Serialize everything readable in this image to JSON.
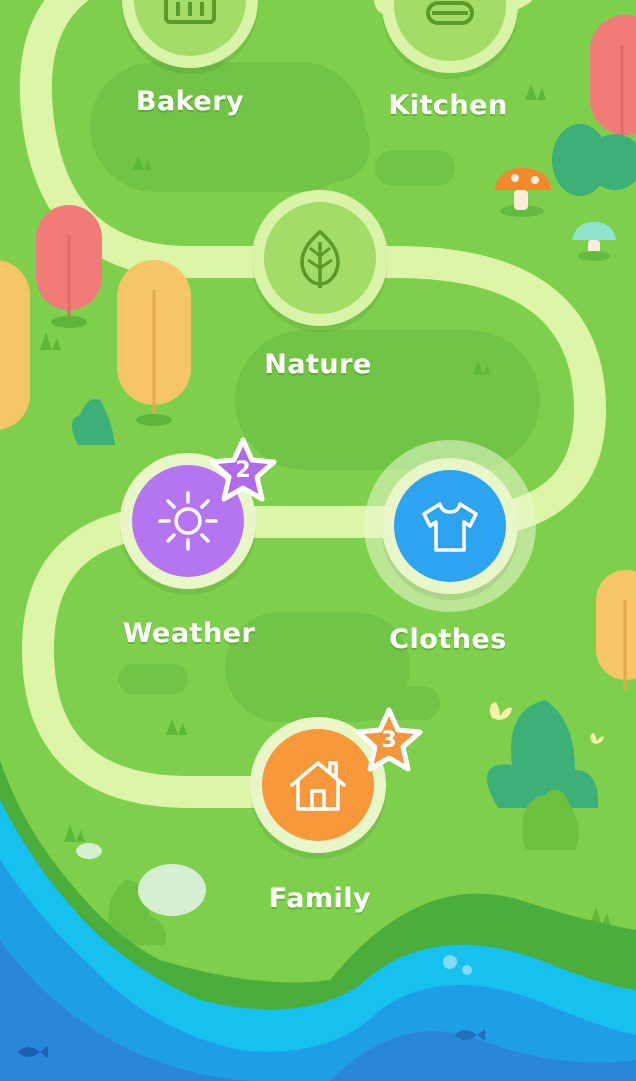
{
  "screen": "lesson-map",
  "colors": {
    "grass": "#7ecf4c",
    "path": "#dcf5a6",
    "weather": "#b574f0",
    "clothes": "#2ea3f2",
    "family": "#f7983a",
    "locked": "#a3dc66",
    "badge_purple": "#b06be8",
    "badge_orange": "#f5963c",
    "water": "#1f9ee8"
  },
  "nodes": [
    {
      "id": "bakery",
      "label": "Bakery",
      "icon": "bread-icon",
      "state": "locked"
    },
    {
      "id": "kitchen",
      "label": "Kitchen",
      "icon": "pot-icon",
      "state": "locked"
    },
    {
      "id": "nature",
      "label": "Nature",
      "icon": "leaf-icon",
      "state": "locked"
    },
    {
      "id": "weather",
      "label": "Weather",
      "icon": "sun-icon",
      "state": "unlocked",
      "stars": "2"
    },
    {
      "id": "clothes",
      "label": "Clothes",
      "icon": "tshirt-icon",
      "state": "current"
    },
    {
      "id": "family",
      "label": "Family",
      "icon": "house-icon",
      "state": "unlocked",
      "stars": "3"
    }
  ]
}
